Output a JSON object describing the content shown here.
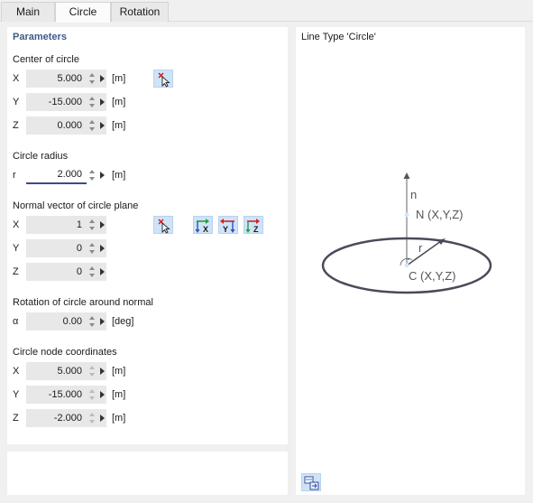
{
  "tabs": [
    {
      "label": "Main"
    },
    {
      "label": "Circle"
    },
    {
      "label": "Rotation"
    }
  ],
  "parameters": {
    "title": "Parameters",
    "center": {
      "label": "Center of circle",
      "rows": [
        {
          "axis": "X",
          "value": "5.000",
          "unit": "[m]"
        },
        {
          "axis": "Y",
          "value": "-15.000",
          "unit": "[m]"
        },
        {
          "axis": "Z",
          "value": "0.000",
          "unit": "[m]"
        }
      ]
    },
    "radius": {
      "label": "Circle radius",
      "axis": "r",
      "value": "2.000",
      "unit": "[m]"
    },
    "normal": {
      "label": "Normal vector of circle plane",
      "rows": [
        {
          "axis": "X",
          "value": "1"
        },
        {
          "axis": "Y",
          "value": "0"
        },
        {
          "axis": "Z",
          "value": "0"
        }
      ],
      "axis_buttons": [
        "X",
        "Y",
        "Z"
      ]
    },
    "rotation": {
      "label": "Rotation of circle around normal",
      "axis": "α",
      "value": "0.00",
      "unit": "[deg]"
    },
    "node": {
      "label": "Circle node coordinates",
      "rows": [
        {
          "axis": "X",
          "value": "5.000",
          "unit": "[m]"
        },
        {
          "axis": "Y",
          "value": "-15.000",
          "unit": "[m]"
        },
        {
          "axis": "Z",
          "value": "-2.000",
          "unit": "[m]"
        }
      ]
    }
  },
  "preview": {
    "title": "Line Type 'Circle'",
    "labels": {
      "n": "n",
      "N": "N (X,Y,Z)",
      "r": "r",
      "C": "C (X,Y,Z)"
    }
  },
  "icons": {
    "pick": "pick-point-icon",
    "axis_x": "axis-x-icon",
    "axis_y": "axis-y-icon",
    "axis_z": "axis-z-icon",
    "preview_tool": "preview-settings-icon"
  },
  "colors": {
    "accent": "#3b5a8a",
    "field_bg": "#e8e8e8",
    "button_bg": "#cfe3f7",
    "ellipse": "#4a4a5a"
  }
}
